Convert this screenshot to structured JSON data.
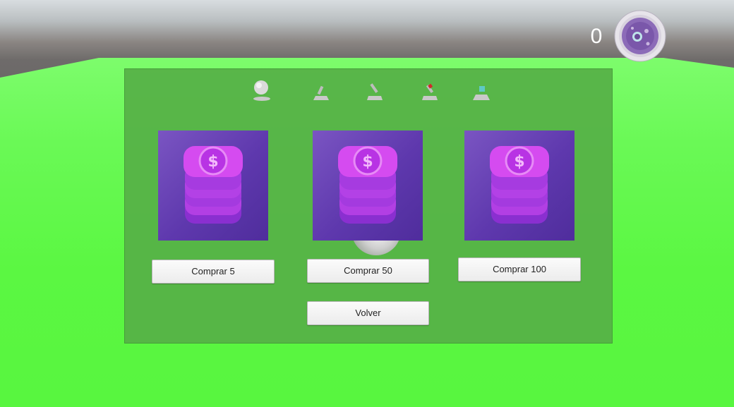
{
  "hud": {
    "coin_count": "0",
    "coin_icon": "purple-coin-medallion-icon"
  },
  "shop": {
    "preview_items": [
      {
        "name": "sphere-item-icon"
      },
      {
        "name": "small-stick-item-icon"
      },
      {
        "name": "tilted-stick-item-icon"
      },
      {
        "name": "red-tip-item-icon"
      },
      {
        "name": "cyan-block-item-icon"
      }
    ],
    "packs": [
      {
        "icon": "coin-stack-icon",
        "button_label": "Comprar 5"
      },
      {
        "icon": "coin-stack-icon",
        "button_label": "Comprar 50"
      },
      {
        "icon": "coin-stack-icon",
        "button_label": "Comprar 100"
      }
    ],
    "back_label": "Volver"
  },
  "colors": {
    "ground": "#5ef742",
    "panel": "#56b046",
    "card": "#6a45b8",
    "coin": "#c13ee6"
  }
}
